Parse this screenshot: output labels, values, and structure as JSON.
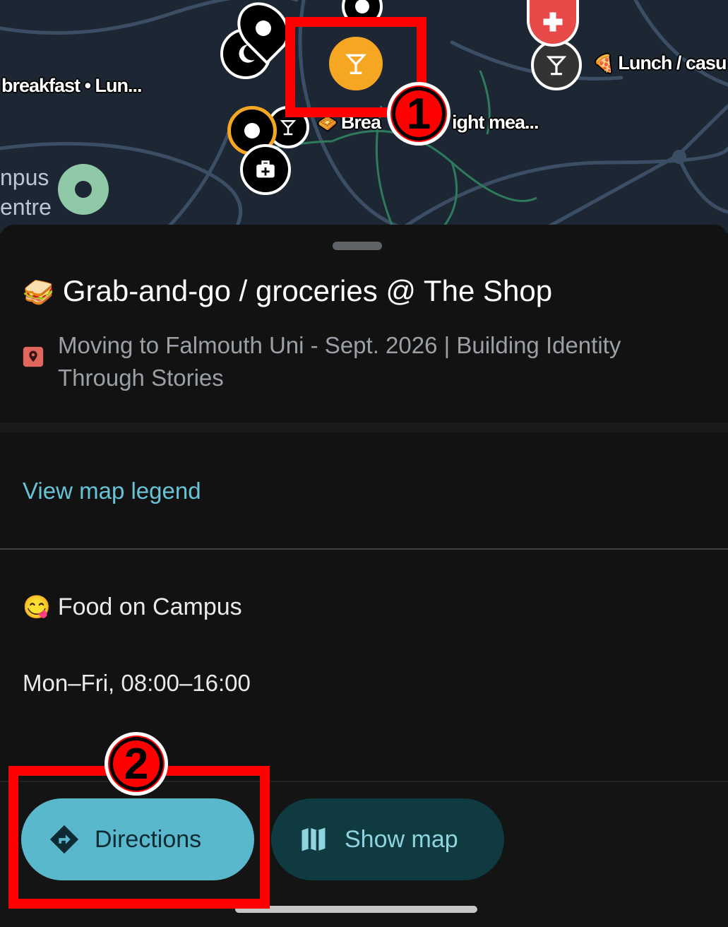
{
  "map": {
    "labels": {
      "breakfast_lunch": "breakfast • Lun...",
      "lunch_casual": "Lunch / casu",
      "breakfast_light": "Brea",
      "light_meals": "ight mea...",
      "campus_line1": "npus",
      "campus_line2": "entre"
    }
  },
  "place": {
    "emoji": "🥪",
    "title": "Grab-and-go / groceries @ The Shop",
    "map_name": "Moving to Falmouth Uni - Sept. 2026 | Building Identity Through Stories"
  },
  "legend_link": "View map legend",
  "list": {
    "emoji": "😋",
    "name": "Food on Campus"
  },
  "hours": "Mon–Fri, 08:00–16:00",
  "actions": {
    "directions": "Directions",
    "show_map": "Show map"
  },
  "annotations": {
    "one": "1",
    "two": "2"
  },
  "colors": {
    "accent": "#5ab8cc",
    "map_bg": "#1d2733",
    "pin_orange": "#f5a623",
    "pin_red": "#e84a4a",
    "annotation": "#ff0000"
  }
}
